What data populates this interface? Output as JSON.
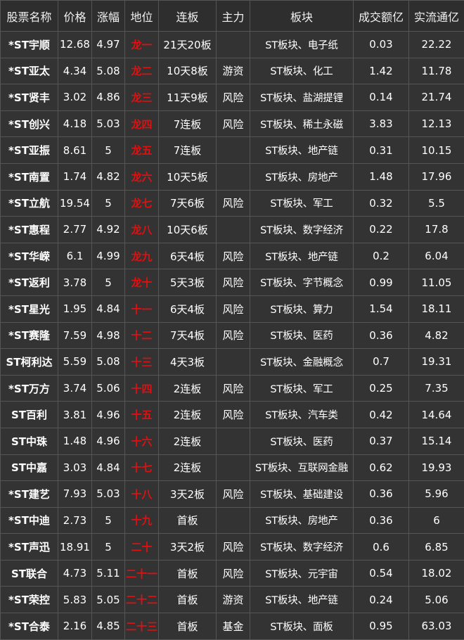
{
  "table": {
    "headers": [
      "股票名称",
      "价格",
      "涨幅",
      "地位",
      "连板",
      "主力",
      "板块",
      "成交额亿",
      "实流通亿"
    ],
    "rows": [
      {
        "name": "*ST宇顺",
        "price": "12.68",
        "change": "4.97",
        "rank": "龙一",
        "streak": "21天20板",
        "main": "",
        "sector": "ST板块、电子纸",
        "turnover": "0.03",
        "float": "22.22"
      },
      {
        "name": "*ST亚太",
        "price": "4.34",
        "change": "5.08",
        "rank": "龙二",
        "streak": "10天8板",
        "main": "游资",
        "sector": "ST板块、化工",
        "turnover": "1.42",
        "float": "11.78"
      },
      {
        "name": "*ST贤丰",
        "price": "3.02",
        "change": "4.86",
        "rank": "龙三",
        "streak": "11天9板",
        "main": "风险",
        "sector": "ST板块、盐湖提锂",
        "turnover": "0.14",
        "float": "21.74"
      },
      {
        "name": "*ST创兴",
        "price": "4.18",
        "change": "5.03",
        "rank": "龙四",
        "streak": "7连板",
        "main": "风险",
        "sector": "ST板块、稀土永磁",
        "turnover": "3.83",
        "float": "12.13"
      },
      {
        "name": "*ST亚振",
        "price": "8.61",
        "change": "5",
        "rank": "龙五",
        "streak": "7连板",
        "main": "",
        "sector": "ST板块、地产链",
        "turnover": "0.31",
        "float": "10.15"
      },
      {
        "name": "*ST南置",
        "price": "1.74",
        "change": "4.82",
        "rank": "龙六",
        "streak": "10天5板",
        "main": "",
        "sector": "ST板块、房地产",
        "turnover": "1.48",
        "float": "17.96"
      },
      {
        "name": "*ST立航",
        "price": "19.54",
        "change": "5",
        "rank": "龙七",
        "streak": "7天6板",
        "main": "风险",
        "sector": "ST板块、军工",
        "turnover": "0.32",
        "float": "5.5"
      },
      {
        "name": "*ST惠程",
        "price": "2.77",
        "change": "4.92",
        "rank": "龙八",
        "streak": "10天6板",
        "main": "",
        "sector": "ST板块、数字经济",
        "turnover": "0.22",
        "float": "17.8"
      },
      {
        "name": "*ST华嵘",
        "price": "6.1",
        "change": "4.99",
        "rank": "龙九",
        "streak": "6天4板",
        "main": "风险",
        "sector": "ST板块、地产链",
        "turnover": "0.2",
        "float": "6.04"
      },
      {
        "name": "*ST返利",
        "price": "3.78",
        "change": "5",
        "rank": "龙十",
        "streak": "5天3板",
        "main": "风险",
        "sector": "ST板块、字节概念",
        "turnover": "0.99",
        "float": "11.05"
      },
      {
        "name": "*ST星光",
        "price": "1.95",
        "change": "4.84",
        "rank": "十一",
        "streak": "6天4板",
        "main": "风险",
        "sector": "ST板块、算力",
        "turnover": "1.54",
        "float": "18.11"
      },
      {
        "name": "*ST赛隆",
        "price": "7.59",
        "change": "4.98",
        "rank": "十二",
        "streak": "7天4板",
        "main": "风险",
        "sector": "ST板块、医药",
        "turnover": "0.36",
        "float": "4.82"
      },
      {
        "name": "ST柯利达",
        "price": "5.59",
        "change": "5.08",
        "rank": "十三",
        "streak": "4天3板",
        "main": "",
        "sector": "ST板块、金融概念",
        "turnover": "0.7",
        "float": "19.31"
      },
      {
        "name": "*ST万方",
        "price": "3.74",
        "change": "5.06",
        "rank": "十四",
        "streak": "2连板",
        "main": "风险",
        "sector": "ST板块、军工",
        "turnover": "0.25",
        "float": "7.35"
      },
      {
        "name": "ST百利",
        "price": "3.81",
        "change": "4.96",
        "rank": "十五",
        "streak": "2连板",
        "main": "风险",
        "sector": "ST板块、汽车类",
        "turnover": "0.42",
        "float": "14.64"
      },
      {
        "name": "ST中珠",
        "price": "1.48",
        "change": "4.96",
        "rank": "十六",
        "streak": "2连板",
        "main": "",
        "sector": "ST板块、医药",
        "turnover": "0.37",
        "float": "15.14"
      },
      {
        "name": "ST中嘉",
        "price": "3.03",
        "change": "4.84",
        "rank": "十七",
        "streak": "2连板",
        "main": "",
        "sector": "ST板块、互联网金融",
        "turnover": "0.62",
        "float": "19.93"
      },
      {
        "name": "*ST建艺",
        "price": "7.93",
        "change": "5.03",
        "rank": "十八",
        "streak": "3天2板",
        "main": "风险",
        "sector": "ST板块、基础建设",
        "turnover": "0.36",
        "float": "5.96"
      },
      {
        "name": "*ST中迪",
        "price": "2.73",
        "change": "5",
        "rank": "十九",
        "streak": "首板",
        "main": "",
        "sector": "ST板块、房地产",
        "turnover": "0.36",
        "float": "6"
      },
      {
        "name": "*ST声迅",
        "price": "18.91",
        "change": "5",
        "rank": "二十",
        "streak": "3天2板",
        "main": "风险",
        "sector": "ST板块、数字经济",
        "turnover": "0.6",
        "float": "6.85"
      },
      {
        "name": "ST联合",
        "price": "4.73",
        "change": "5.11",
        "rank": "二十一",
        "streak": "首板",
        "main": "风险",
        "sector": "ST板块、元宇宙",
        "turnover": "0.54",
        "float": "18.02"
      },
      {
        "name": "*ST荣控",
        "price": "5.83",
        "change": "5.05",
        "rank": "二十二",
        "streak": "首板",
        "main": "游资",
        "sector": "ST板块、地产链",
        "turnover": "0.24",
        "float": "5.06"
      },
      {
        "name": "*ST合泰",
        "price": "2.16",
        "change": "4.85",
        "rank": "二十三",
        "streak": "首板",
        "main": "基金",
        "sector": "ST板块、面板",
        "turnover": "0.95",
        "float": "63.03"
      }
    ]
  },
  "colors": {
    "background": "#333333",
    "border": "#555555",
    "text": "#ffffff",
    "rank_text": "#e01010"
  }
}
